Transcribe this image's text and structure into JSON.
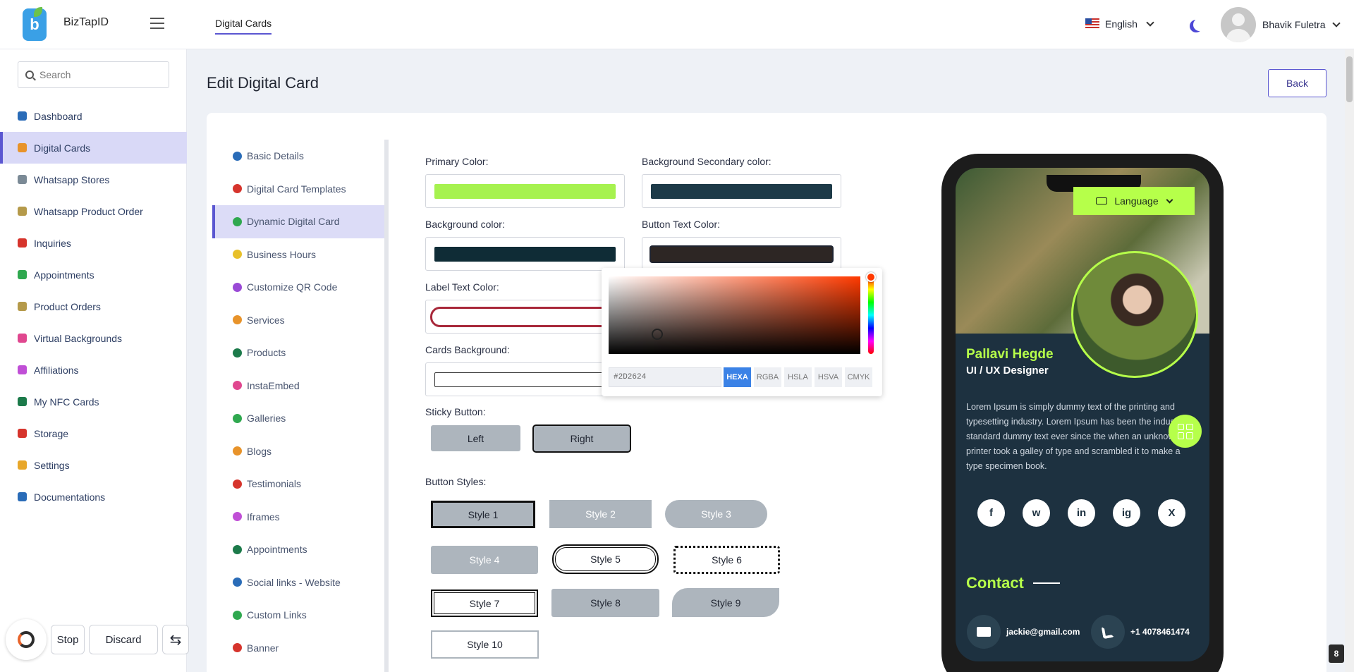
{
  "header": {
    "brand": "BizTapID",
    "tab": "Digital Cards",
    "language": "English",
    "username": "Bhavik Fuletra"
  },
  "sidebar": {
    "search_placeholder": "Search",
    "items": [
      {
        "label": "Dashboard",
        "icon": "dashboard-icon",
        "color": "#2a6cb8"
      },
      {
        "label": "Digital Cards",
        "icon": "card-icon",
        "color": "#e8932a",
        "active": true
      },
      {
        "label": "Whatsapp Stores",
        "icon": "whatsapp-icon",
        "color": "#7b8a96"
      },
      {
        "label": "Whatsapp Product Order",
        "icon": "order-icon",
        "color": "#b59a4a"
      },
      {
        "label": "Inquiries",
        "icon": "info-icon",
        "color": "#d6342c"
      },
      {
        "label": "Appointments",
        "icon": "calendar-icon",
        "color": "#2fa84f"
      },
      {
        "label": "Product Orders",
        "icon": "product-icon",
        "color": "#b59a4a"
      },
      {
        "label": "Virtual Backgrounds",
        "icon": "background-icon",
        "color": "#e0478f"
      },
      {
        "label": "Affiliations",
        "icon": "affiliation-icon",
        "color": "#c04fd6"
      },
      {
        "label": "My NFC Cards",
        "icon": "nfc-icon",
        "color": "#1c7a4a"
      },
      {
        "label": "Storage",
        "icon": "storage-icon",
        "color": "#d6342c"
      },
      {
        "label": "Settings",
        "icon": "gear-icon",
        "color": "#e8a72a"
      },
      {
        "label": "Documentations",
        "icon": "document-icon",
        "color": "#2a6cb8"
      }
    ]
  },
  "main": {
    "title": "Edit Digital Card",
    "back_label": "Back"
  },
  "subnav": {
    "items": [
      {
        "label": "Basic Details",
        "color": "#2a6cb8"
      },
      {
        "label": "Digital Card Templates",
        "color": "#d6342c"
      },
      {
        "label": "Dynamic Digital Card",
        "color": "#2fa84f",
        "active": true
      },
      {
        "label": "Business Hours",
        "color": "#e8c02a"
      },
      {
        "label": "Customize QR Code",
        "color": "#9a4ad6"
      },
      {
        "label": "Services",
        "color": "#e8932a"
      },
      {
        "label": "Products",
        "color": "#1c7a4a"
      },
      {
        "label": "InstaEmbed",
        "color": "#e0478f"
      },
      {
        "label": "Galleries",
        "color": "#2fa84f"
      },
      {
        "label": "Blogs",
        "color": "#e8932a"
      },
      {
        "label": "Testimonials",
        "color": "#d6342c"
      },
      {
        "label": "Iframes",
        "color": "#c04fd6"
      },
      {
        "label": "Appointments",
        "color": "#1c7a4a"
      },
      {
        "label": "Social links - Website",
        "color": "#2a6cb8"
      },
      {
        "label": "Custom Links",
        "color": "#2fa84f"
      },
      {
        "label": "Banner",
        "color": "#d6342c"
      }
    ]
  },
  "form": {
    "primary_color_label": "Primary Color:",
    "primary_color": "#a6f24f",
    "bg_secondary_label": "Background Secondary color:",
    "bg_secondary_color": "#1d3a48",
    "bg_color_label": "Background color:",
    "bg_color": "#0f2c36",
    "button_text_label": "Button Text Color:",
    "button_text_color": "#2d2624",
    "label_text_label": "Label Text Color:",
    "cards_bg_label": "Cards Background:",
    "sticky_label": "Sticky Button:",
    "sticky_left": "Left",
    "sticky_right": "Right",
    "button_styles_label": "Button Styles:",
    "styles": [
      "Style 1",
      "Style 2",
      "Style 3",
      "Style 4",
      "Style 5",
      "Style 6",
      "Style 7",
      "Style 8",
      "Style 9",
      "Style 10"
    ]
  },
  "picker": {
    "value": "#2D2624",
    "modes": [
      "HEXA",
      "RGBA",
      "HSLA",
      "HSVA",
      "CMYK"
    ],
    "active_mode": "HEXA"
  },
  "preview": {
    "language_btn": "Language",
    "name": "Pallavi Hegde",
    "role": "UI / UX Designer",
    "description": "Lorem Ipsum is simply dummy text of the printing and typesetting industry. Lorem Ipsum has been the industry's standard dummy text ever since the when an unknown printer took a galley of type and scrambled it to make a type specimen book.",
    "socials": [
      "f",
      "w",
      "in",
      "ig",
      "X"
    ],
    "contact_title": "Contact",
    "email": "jackie@gmail.com",
    "phone": "+1 4078461474"
  },
  "overlay": {
    "stop": "Stop",
    "discard": "Discard"
  },
  "corner_badge": "8"
}
